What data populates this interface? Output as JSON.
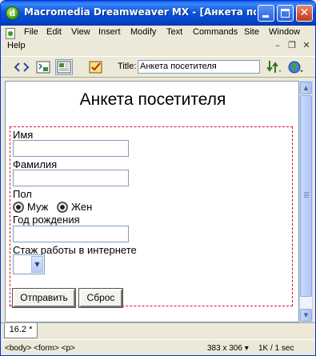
{
  "window": {
    "title": "Macromedia Dreamweaver MX - [Анкета посетителя (...)]",
    "app_icon_letter": "d"
  },
  "menu": {
    "items": [
      "File",
      "Edit",
      "View",
      "Insert",
      "Modify",
      "Text",
      "Commands",
      "Site",
      "Window",
      "Help"
    ]
  },
  "toolbar": {
    "title_label": "Title:",
    "title_value": "Анкета посетителя",
    "icons": [
      "code-view-icon",
      "split-view-icon",
      "design-view-icon",
      "check-browser-icon",
      "file-management-icon",
      "preview-in-browser-icon"
    ]
  },
  "document": {
    "heading": "Анкета посетителя",
    "fields": {
      "name_label": "Имя",
      "surname_label": "Фамилия",
      "gender_label": "Пол",
      "gender_options": [
        "Муж",
        "Жен"
      ],
      "birth_year_label": "Год рождения",
      "experience_label": "Стаж работы в интернете"
    },
    "buttons": {
      "submit": "Отправить",
      "reset": "Сброс"
    }
  },
  "tabs": {
    "active": "16.2 *"
  },
  "status": {
    "tag_path": "<body> <form> <p>",
    "window_size": "383 x 306",
    "download": "1K / 1 sec"
  },
  "colors": {
    "title_bar": "#0a56e0",
    "form_outline": "#e0102a",
    "input_border": "#7f9db9",
    "chrome": "#ece9d8"
  }
}
